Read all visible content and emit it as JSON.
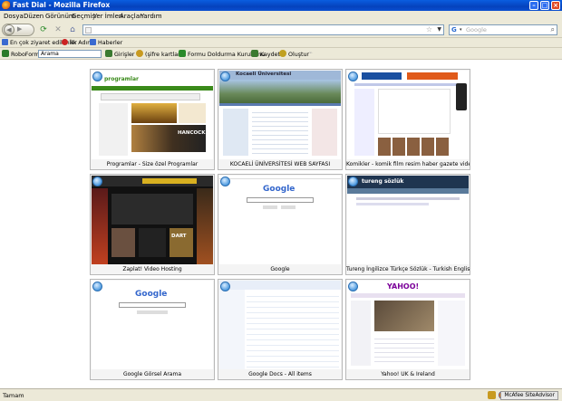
{
  "window": {
    "title": "Fast Dial - Mozilla Firefox"
  },
  "menu": [
    "Dosya",
    "Düzen",
    "Görünüm",
    "Geçmiş",
    "Yer İmleri",
    "Araçlar",
    "Yardım"
  ],
  "search": {
    "placeholder": "Google"
  },
  "bookmarks": [
    {
      "label": "En çok ziyaret edilenler",
      "color": "#3a6ad0"
    },
    {
      "label": "İlk Adım",
      "color": "#cc2222"
    },
    {
      "label": "Haberler",
      "color": "#3a6ad0"
    }
  ],
  "roboform": {
    "brand": "RoboForm",
    "search_value": "Arama",
    "items": [
      {
        "label": "Girişler",
        "color": "#3a7a30"
      },
      {
        "label": "(şifre kartları)",
        "color": "#c89a20"
      },
      {
        "label": "Formu Doldurma Kurulumu",
        "color": "#2a8a2a"
      },
      {
        "label": "Kaydet",
        "color": "#3a7a30"
      },
      {
        "label": "Oluştur",
        "color": "#c0a020"
      }
    ]
  },
  "dials": [
    {
      "label": "Programlar - Size özel Programlar"
    },
    {
      "label": "KOCAELİ ÜNİVERSİTESİ WEB SAYFASI"
    },
    {
      "label": "Komikler - komik film resim haber gazete video komik resim"
    },
    {
      "label": "Zaplat! Video Hosting"
    },
    {
      "label": "Google"
    },
    {
      "label": "Tureng İngilizce Türkçe Sözlük - Turkish English Online Dic"
    },
    {
      "label": "Google Görsel Arama"
    },
    {
      "label": "Google Docs - All items"
    },
    {
      "label": "Yahoo! UK & Ireland"
    }
  ],
  "thumbs": {
    "programlar_logo": "programlar",
    "kocaeli_title": "Kocaeli Üniversitesi",
    "google_logo": "Google",
    "tureng_logo": "tureng sözlük",
    "yahoo_logo": "YAHOO!",
    "hancock": "HANCOCK",
    "dart": "DART"
  },
  "status": {
    "text": "Tamam",
    "mcafee": "McAfee SiteAdvisor"
  }
}
